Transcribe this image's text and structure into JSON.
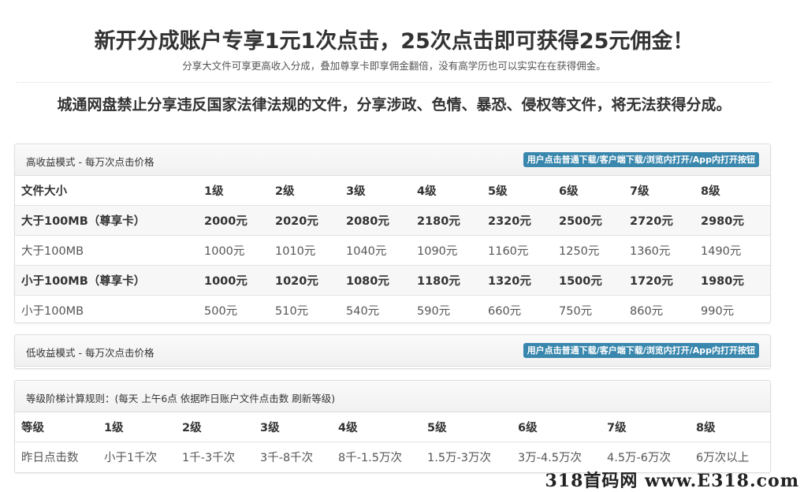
{
  "header": {
    "headline": "新开分成账户专享1元1次点击，25次点击即可获得25元佣金！",
    "subline": "分享大文件可享更高收入分成，叠加尊享卡即享佣金翻倍，没有高学历也可以实实在在获得佣金。",
    "warning": "城通网盘禁止分享违反国家法律法规的文件，分享涉政、色情、暴恐、侵权等文件，将无法获得分成。"
  },
  "high_panel": {
    "title": "高收益模式 - 每万次点击价格",
    "badge": "用户点击普通下载/客户端下载/浏览内打开/App内打开按钮",
    "columns": [
      "文件大小",
      "1级",
      "2级",
      "3级",
      "4级",
      "5级",
      "6级",
      "7级",
      "8级"
    ],
    "rows": [
      {
        "label": "大于100MB（尊享卡）",
        "values": [
          "2000元",
          "2020元",
          "2080元",
          "2180元",
          "2320元",
          "2500元",
          "2720元",
          "2980元"
        ]
      },
      {
        "label": "大于100MB",
        "values": [
          "1000元",
          "1010元",
          "1040元",
          "1090元",
          "1160元",
          "1250元",
          "1360元",
          "1490元"
        ]
      },
      {
        "label": "小于100MB（尊享卡）",
        "values": [
          "1000元",
          "1020元",
          "1080元",
          "1180元",
          "1320元",
          "1500元",
          "1720元",
          "1980元"
        ]
      },
      {
        "label": "小于100MB",
        "values": [
          "500元",
          "510元",
          "540元",
          "590元",
          "660元",
          "750元",
          "860元",
          "990元"
        ]
      }
    ]
  },
  "low_panel": {
    "title": "低收益模式 - 每万次点击价格",
    "badge": "用户点击普通下载/客户端下载/浏览内打开/App内打开按钮"
  },
  "level_panel": {
    "title": "等级阶梯计算规则：(每天 上午6点 依据昨日账户文件点击数 刷新等级)",
    "columns": [
      "等级",
      "1级",
      "2级",
      "3级",
      "4级",
      "5级",
      "6级",
      "7级",
      "8级"
    ],
    "row": {
      "label": "昨日点击数",
      "values": [
        "小于1千次",
        "1千-3千次",
        "3千-8千次",
        "8千-1.5万次",
        "1.5万-3万次",
        "3万-4.5万次",
        "4.5万-6万次",
        "6万次以上"
      ]
    }
  },
  "watermark": "318首码网 www.E318.com"
}
